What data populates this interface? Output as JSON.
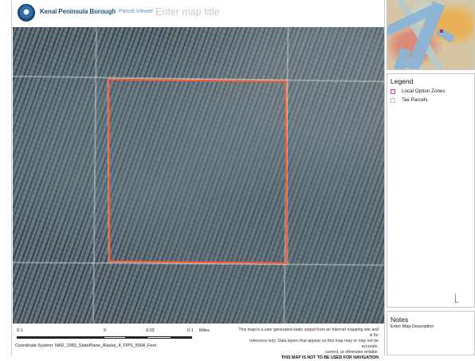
{
  "header": {
    "brand": "Kenai Peninsula Borough",
    "subtitle": "Parcel Viewer",
    "map_title_placeholder": "Enter map title"
  },
  "legend": {
    "title": "Legend",
    "items": [
      {
        "label": "Local Option Zones",
        "color": "#d23bbd"
      },
      {
        "label": "Tax Parcels",
        "color": "#bfbfbf"
      }
    ]
  },
  "notes": {
    "title": "Notes",
    "description": "Enter Map Description"
  },
  "scale": {
    "left": "0.1",
    "zero": "0",
    "mid": "0.03",
    "right": "0.1",
    "units": "Miles"
  },
  "coordinate_system": "Coordinate System:  NAD_1983_StatePlane_Alaska_4_FIPS_5004_Feet",
  "disclaimer": {
    "line1": "This map is a user generated static output from an Internet mapping site and is for",
    "line2": "reference only. Data layers that appear on this map may or may not be accurate,",
    "line3": "current, or otherwise reliable.",
    "line4": "THIS MAP IS NOT TO BE USED FOR NAVIGATION"
  },
  "colors": {
    "parcel_outline": "#ff5a2f",
    "brand": "#1e4f82"
  },
  "icons": {
    "logo": "borough-seal-icon"
  }
}
